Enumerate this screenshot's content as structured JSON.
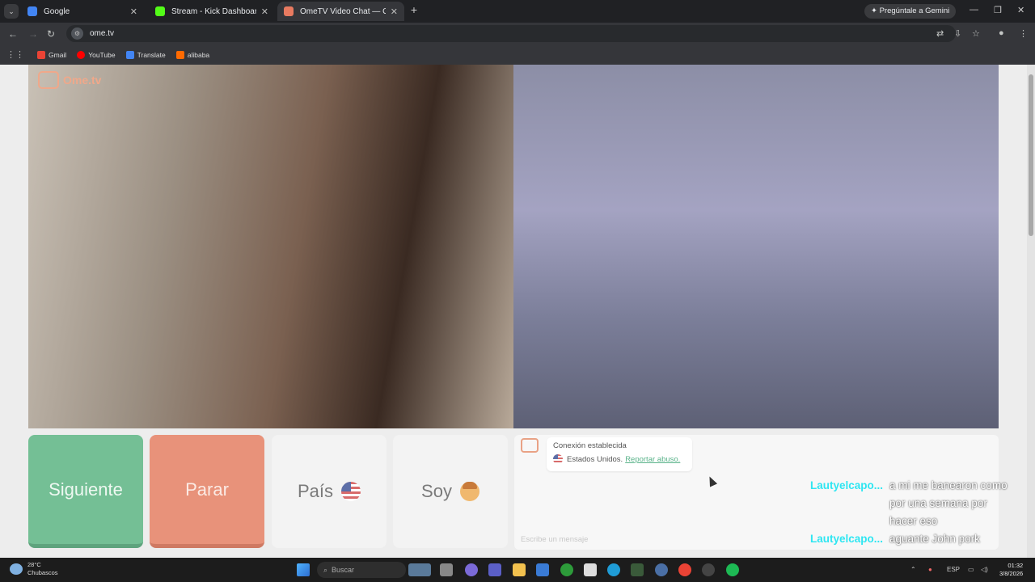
{
  "browser": {
    "tabs": [
      {
        "title": "Google",
        "favicon_color": "#4285f4"
      },
      {
        "title": "Stream - Kick Dashboard",
        "favicon_color": "#53fc18"
      },
      {
        "title": "OmeTV Video Chat — Ome",
        "favicon_color": "#e87a60"
      }
    ],
    "gemini_label": "Pregúntale a Gemini",
    "url": "ome.tv",
    "bookmarks": [
      {
        "label": "Gmail",
        "color": "#ea4335"
      },
      {
        "label": "YouTube",
        "color": "#ff0000"
      },
      {
        "label": "Translate",
        "color": "#4285f4"
      },
      {
        "label": "alibaba",
        "color": "#ff6a00"
      }
    ]
  },
  "ometv": {
    "logo_text": "Ome.tv",
    "buttons": {
      "next": "Siguiente",
      "stop": "Parar",
      "country": "País",
      "gender": "Soy"
    },
    "chat": {
      "status": "Conexión establecida",
      "country": "Estados Unidos.",
      "report_link": "Reportar abuso.",
      "input_placeholder": "Escribe un mensaje"
    }
  },
  "stream_overlay": [
    {
      "user": "Lautyelcapo...",
      "text": "a mi me banearon como por una semana por hacer eso"
    },
    {
      "user": "Lautyelcapo...",
      "text": "aguante John pork"
    }
  ],
  "taskbar": {
    "weather_temp": "28°C",
    "weather_desc": "Chubascos",
    "search_placeholder": "Buscar",
    "language": "ESP",
    "time": "01:32",
    "date": "3/8/2026"
  }
}
